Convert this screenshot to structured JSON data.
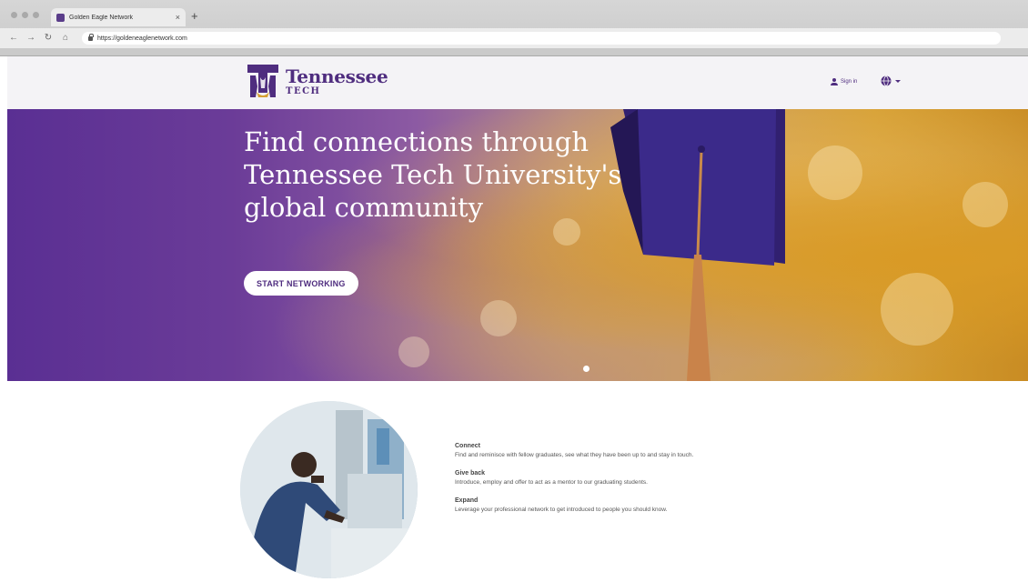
{
  "browser": {
    "tab_title": "Golden Eagle Network",
    "tab_close": "×",
    "new_tab": "+",
    "url": "https://goldeneaglenetwork.com"
  },
  "header": {
    "logo_name": "Tennessee",
    "logo_sub": "TECH",
    "sign_in": "Sign in"
  },
  "hero": {
    "title": "Find connections through Tennessee Tech University's global community",
    "cta": "START NETWORKING"
  },
  "features": [
    {
      "title": "Connect",
      "desc": "Find and reminisce with fellow graduates, see what they have been up to and stay in touch."
    },
    {
      "title": "Give back",
      "desc": "Introduce, employ and offer to act as a mentor to our graduating students."
    },
    {
      "title": "Expand",
      "desc": "Leverage your professional network to get introduced to people you should know."
    }
  ],
  "colors": {
    "brand_purple": "#4f2d7f",
    "gold": "#d6a033"
  },
  "icons": [
    "back-icon",
    "forward-icon",
    "reload-icon",
    "home-icon",
    "lock-icon",
    "person-icon",
    "globe-icon",
    "chevron-down-icon"
  ]
}
